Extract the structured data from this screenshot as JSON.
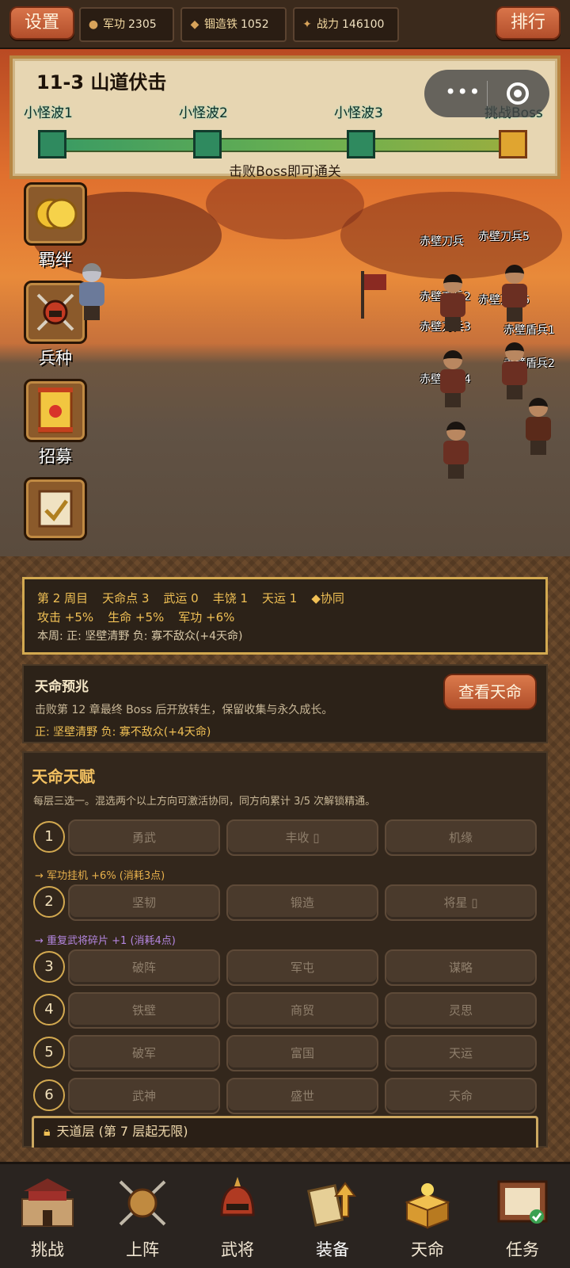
{
  "top": {
    "settings": "设置",
    "rank": "排行",
    "resources": [
      {
        "icon": "medal-icon",
        "label": "军功",
        "value": "2305"
      },
      {
        "icon": "ingot-icon",
        "label": "锢造铁",
        "value": "1052"
      },
      {
        "icon": "sword-crest-icon",
        "label": "战力",
        "value": "146100"
      }
    ]
  },
  "stage": {
    "title": "11-3 山道伏击",
    "waves": [
      "小怪波1",
      "小怪波2",
      "小怪波3",
      "挑战Boss"
    ],
    "hint": "击败Boss即可通关"
  },
  "side_buttons": [
    {
      "label": "羁绊"
    },
    {
      "label": "兵种"
    },
    {
      "label": "招募"
    },
    {
      "label": ""
    }
  ],
  "enemies": [
    "赤壁刀兵5",
    "赤壁刀兵2",
    "赤壁刀兵6",
    "赤壁刀兵3",
    "赤壁盾兵1",
    "赤壁盾兵2",
    "赤壁刀兵4",
    "赤壁刀兵"
  ],
  "stats": {
    "row1": [
      "第 2 周目",
      "天命点 3",
      "武运 0",
      "丰饶 1",
      "天运 1",
      "◆协同"
    ],
    "row2": [
      "攻击 +5%",
      "生命 +5%",
      "军功 +6%"
    ],
    "row3": "本周: 正: 坚壁清野  负: 寡不敌众(+4天命)"
  },
  "omen": {
    "title": "天命预兆",
    "desc": "击败第 12 章最终 Boss 后开放转生，保留收集与永久成长。",
    "effect": "正: 坚壁清野  负: 寡不敌众(+4天命)",
    "button": "查看天命"
  },
  "talent": {
    "title": "天命天赋",
    "desc": "每层三选一。混选两个以上方向可激活协同，同方向累计 3/5 次解锁精通。",
    "tiers": [
      {
        "num": "1",
        "options": [
          "勇武",
          "丰收 ▯",
          "机缘"
        ],
        "effect": "→ 军功挂机 +6% (消耗3点)",
        "effect_color": "#e8b14c"
      },
      {
        "num": "2",
        "options": [
          "坚韧",
          "锻造",
          "将星 ▯"
        ],
        "effect": "→ 重复武将碎片 +1 (消耗4点)",
        "effect_color": "#b486e0"
      },
      {
        "num": "3",
        "options": [
          "破阵",
          "军屯",
          "谋略"
        ]
      },
      {
        "num": "4",
        "options": [
          "铁壁",
          "商贸",
          "灵思"
        ]
      },
      {
        "num": "5",
        "options": [
          "破军",
          "富国",
          "天运"
        ]
      },
      {
        "num": "6",
        "options": [
          "武神",
          "盛世",
          "天命"
        ]
      }
    ],
    "locked": "天道层 (第 7 层起无限)"
  },
  "nav": [
    {
      "label": "挑战",
      "icon": "castle-icon"
    },
    {
      "label": "上阵",
      "icon": "crossed-swords-shield-icon"
    },
    {
      "label": "武将",
      "icon": "helmet-icon"
    },
    {
      "label": "装备",
      "icon": "scroll-upgrade-icon"
    },
    {
      "label": "天命",
      "icon": "treasure-box-icon"
    },
    {
      "label": "任务",
      "icon": "quest-board-icon"
    }
  ],
  "colors": {
    "accent": "#d3a950",
    "button_red": "#c4603a",
    "bg": "#3a2a1c"
  }
}
